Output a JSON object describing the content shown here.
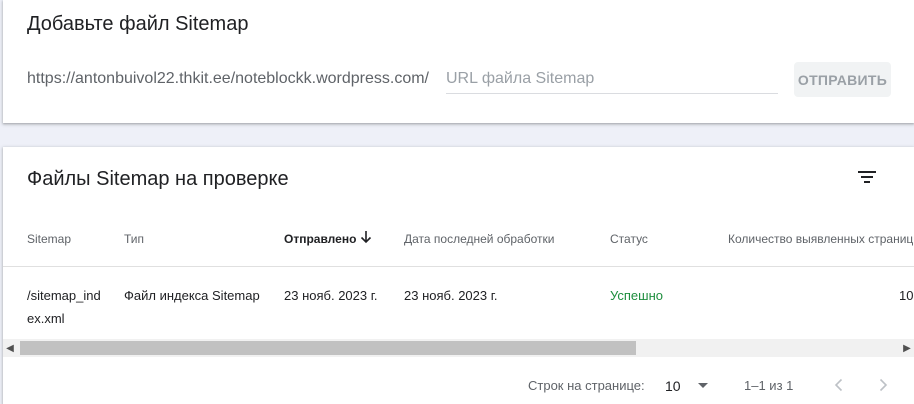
{
  "add_sitemap": {
    "title": "Добавьте файл Sitemap",
    "url_prefix": "https://antonbuivol22.thkit.ee/noteblockk.wordpress.com/",
    "input_value": "",
    "input_placeholder": "URL файла Sitemap",
    "submit_label": "ОТПРАВИТЬ"
  },
  "submitted": {
    "title": "Файлы Sitemap на проверке",
    "columns": {
      "sitemap": "Sitemap",
      "type": "Тип",
      "submitted": "Отправлено",
      "last_read": "Дата последней обработки",
      "status": "Статус",
      "discovered": "Количество выявленных страниц"
    },
    "rows": [
      {
        "sitemap": "/sitemap_index.xml",
        "type": "Файл индекса Sitemap",
        "submitted": "23 нояб. 2023 г.",
        "last_read": "23 нояб. 2023 г.",
        "status": "Успешно",
        "discovered": "10"
      }
    ],
    "scroll_fraction": 0.68
  },
  "pagination": {
    "rows_per_page_label": "Строк на странице:",
    "rows_per_page": "10",
    "range": "1–1 из 1"
  },
  "colors": {
    "success": "#1e8e3e",
    "muted": "#5f6368",
    "disabled_button": "#f1f3f4"
  }
}
